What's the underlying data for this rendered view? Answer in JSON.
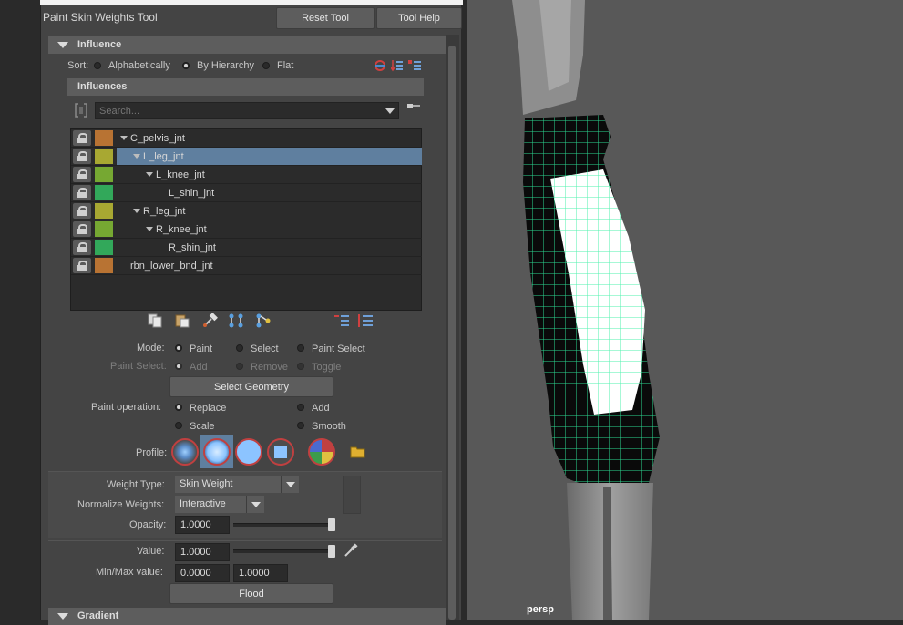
{
  "tool_title": "Paint Skin Weights Tool",
  "buttons": {
    "reset": "Reset Tool",
    "help": "Tool Help"
  },
  "influence_header": "Influence",
  "sort": {
    "label": "Sort:",
    "options": [
      "Alphabetically",
      "By Hierarchy",
      "Flat"
    ],
    "selected": "By Hierarchy"
  },
  "influences_header": "Influences",
  "search": {
    "placeholder": "Search...",
    "value": ""
  },
  "joints": [
    {
      "name": "C_pelvis_jnt",
      "color": "#b87333",
      "depth": 0,
      "expanded": true,
      "selected": false
    },
    {
      "name": "L_leg_jnt",
      "color": "#a8a832",
      "depth": 1,
      "expanded": true,
      "selected": true
    },
    {
      "name": "L_knee_jnt",
      "color": "#76a832",
      "depth": 2,
      "expanded": true,
      "selected": false
    },
    {
      "name": "L_shin_jnt",
      "color": "#32a85a",
      "depth": 3,
      "expanded": false,
      "selected": false
    },
    {
      "name": "R_leg_jnt",
      "color": "#a8a832",
      "depth": 1,
      "expanded": true,
      "selected": false
    },
    {
      "name": "R_knee_jnt",
      "color": "#76a832",
      "depth": 2,
      "expanded": true,
      "selected": false
    },
    {
      "name": "R_shin_jnt",
      "color": "#32a85a",
      "depth": 3,
      "expanded": false,
      "selected": false
    },
    {
      "name": "rbn_lower_bnd_jnt",
      "color": "#b87333",
      "depth": 0,
      "expanded": false,
      "selected": false
    }
  ],
  "mode": {
    "label": "Mode:",
    "options": [
      "Paint",
      "Select",
      "Paint Select"
    ],
    "selected": "Paint"
  },
  "paint_select": {
    "label": "Paint Select:",
    "options": [
      "Add",
      "Remove",
      "Toggle"
    ],
    "selected": "Add",
    "enabled": false
  },
  "select_geometry": "Select Geometry",
  "paint_operation": {
    "label": "Paint operation:",
    "options": [
      "Replace",
      "Add",
      "Scale",
      "Smooth"
    ],
    "selected": "Replace"
  },
  "profile": {
    "label": "Profile:",
    "selected_index": 1
  },
  "weight_type": {
    "label": "Weight Type:",
    "value": "Skin Weight"
  },
  "normalize": {
    "label": "Normalize Weights:",
    "value": "Interactive"
  },
  "opacity": {
    "label": "Opacity:",
    "value": "1.0000",
    "level": 1.0
  },
  "value": {
    "label": "Value:",
    "value": "1.0000",
    "level": 1.0
  },
  "minmax": {
    "label": "Min/Max value:",
    "min": "0.0000",
    "max": "1.0000"
  },
  "flood": "Flood",
  "gradient_header": "Gradient",
  "viewport": {
    "camera": "persp"
  },
  "colors": {
    "selection": "#5f7f9f",
    "wire": "#30f0a0",
    "profile_ring": "#c04040"
  }
}
